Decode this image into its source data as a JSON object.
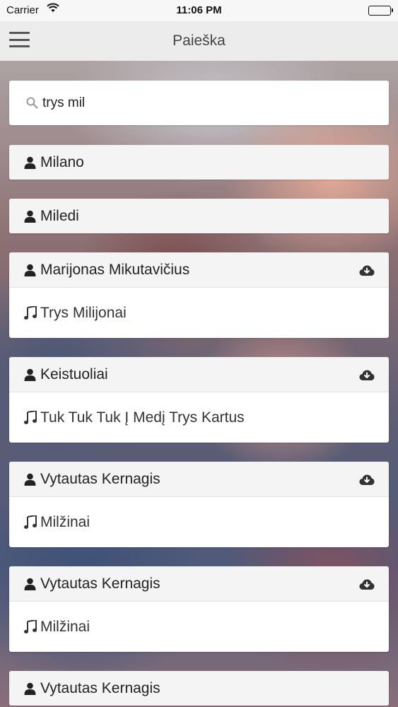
{
  "status_bar": {
    "carrier": "Carrier",
    "time": "11:06 PM"
  },
  "nav": {
    "title": "Paieška",
    "menu_icon": "hamburger-menu-icon"
  },
  "search": {
    "value": "trys mil",
    "placeholder": "",
    "icon": "search-icon"
  },
  "results": [
    {
      "artist": "Milano"
    },
    {
      "artist": "Miledi"
    },
    {
      "artist": "Marijonas Mikutavičius",
      "song": "Trys Milijonai"
    },
    {
      "artist": "Keistuoliai",
      "song": "Tuk Tuk Tuk Į Medį Trys Kartus"
    },
    {
      "artist": "Vytautas Kernagis",
      "song": "Milžinai"
    },
    {
      "artist": "Vytautas Kernagis",
      "song": "Milžinai"
    },
    {
      "artist": "Vytautas Kernagis"
    }
  ],
  "colors": {
    "header_bg": "#f4f4f4",
    "icon": "#222222"
  }
}
